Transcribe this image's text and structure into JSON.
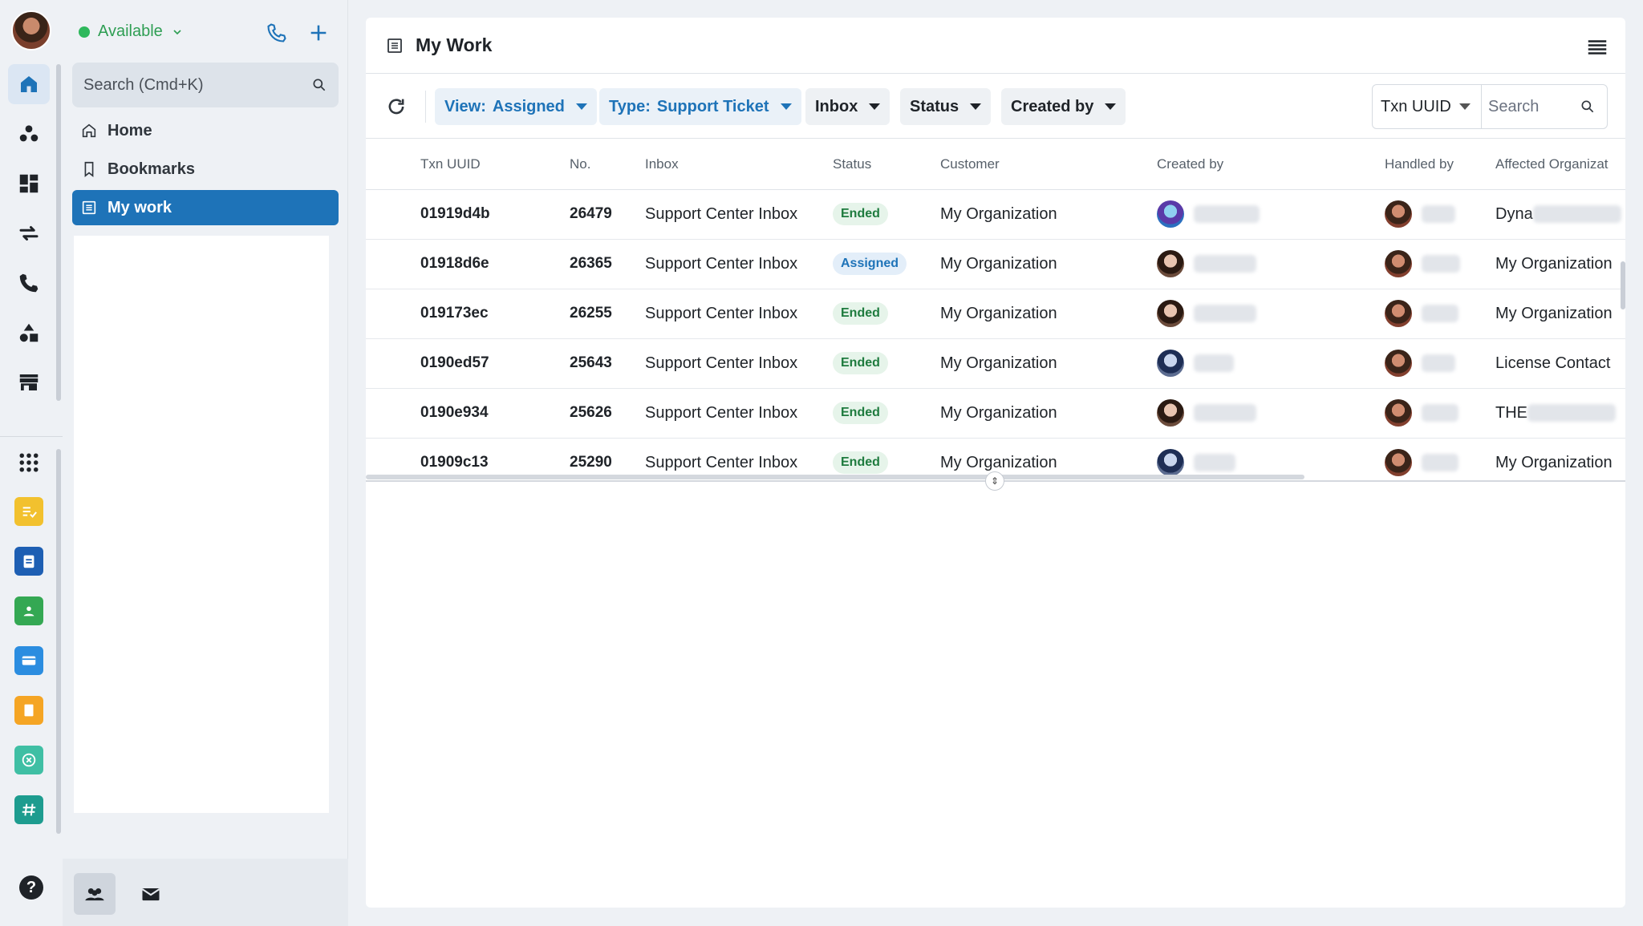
{
  "presence": {
    "status": "Available"
  },
  "search": {
    "placeholder": "Search (Cmd+K)"
  },
  "nav": [
    {
      "label": "Home"
    },
    {
      "label": "Bookmarks"
    },
    {
      "label": "My work"
    }
  ],
  "main": {
    "title": "My Work"
  },
  "filters": {
    "view_prefix": "View:",
    "view_value": "Assigned",
    "type_prefix": "Type:",
    "type_value": "Support Ticket",
    "inbox": "Inbox",
    "status": "Status",
    "created_by": "Created by"
  },
  "txn_search": {
    "field": "Txn UUID",
    "placeholder": "Search"
  },
  "table": {
    "columns": [
      "Txn UUID",
      "No.",
      "Inbox",
      "Status",
      "Customer",
      "Created by",
      "Handled by",
      "Affected Organizat"
    ],
    "rows": [
      {
        "uuid": "01919d4b",
        "no": "26479",
        "inbox": "Support Center Inbox",
        "status": "Ended",
        "customer": "My Organization",
        "created_avatar": "d",
        "handled_avatar": "a",
        "affected": "Dyna",
        "affected_blur": true
      },
      {
        "uuid": "01918d6e",
        "no": "26365",
        "inbox": "Support Center Inbox",
        "status": "Assigned",
        "customer": "My Organization",
        "created_avatar": "b",
        "handled_avatar": "a",
        "affected": "My Organization",
        "affected_blur": false
      },
      {
        "uuid": "019173ec",
        "no": "26255",
        "inbox": "Support Center Inbox",
        "status": "Ended",
        "customer": "My Organization",
        "created_avatar": "b",
        "handled_avatar": "a",
        "affected": "My Organization",
        "affected_blur": false
      },
      {
        "uuid": "0190ed57",
        "no": "25643",
        "inbox": "Support Center Inbox",
        "status": "Ended",
        "customer": "My Organization",
        "created_avatar": "c",
        "handled_avatar": "a",
        "affected": "License Contact",
        "affected_blur": false
      },
      {
        "uuid": "0190e934",
        "no": "25626",
        "inbox": "Support Center Inbox",
        "status": "Ended",
        "customer": "My Organization",
        "created_avatar": "b",
        "handled_avatar": "a",
        "affected": "THE",
        "affected_blur": true
      },
      {
        "uuid": "01909c13",
        "no": "25290",
        "inbox": "Support Center Inbox",
        "status": "Ended",
        "customer": "My Organization",
        "created_avatar": "c",
        "handled_avatar": "a",
        "affected": "My Organization",
        "affected_blur": false
      }
    ]
  },
  "colors": {
    "accent": "#1e73b8",
    "presence": "#2eb85c",
    "ended_badge": "#1e7b3e"
  },
  "icons": [
    "home-icon",
    "contacts-icon",
    "dashboard-icon",
    "transfer-icon",
    "phone-icon",
    "shapes-icon",
    "store-icon",
    "apps-grid-icon",
    "help-icon"
  ]
}
